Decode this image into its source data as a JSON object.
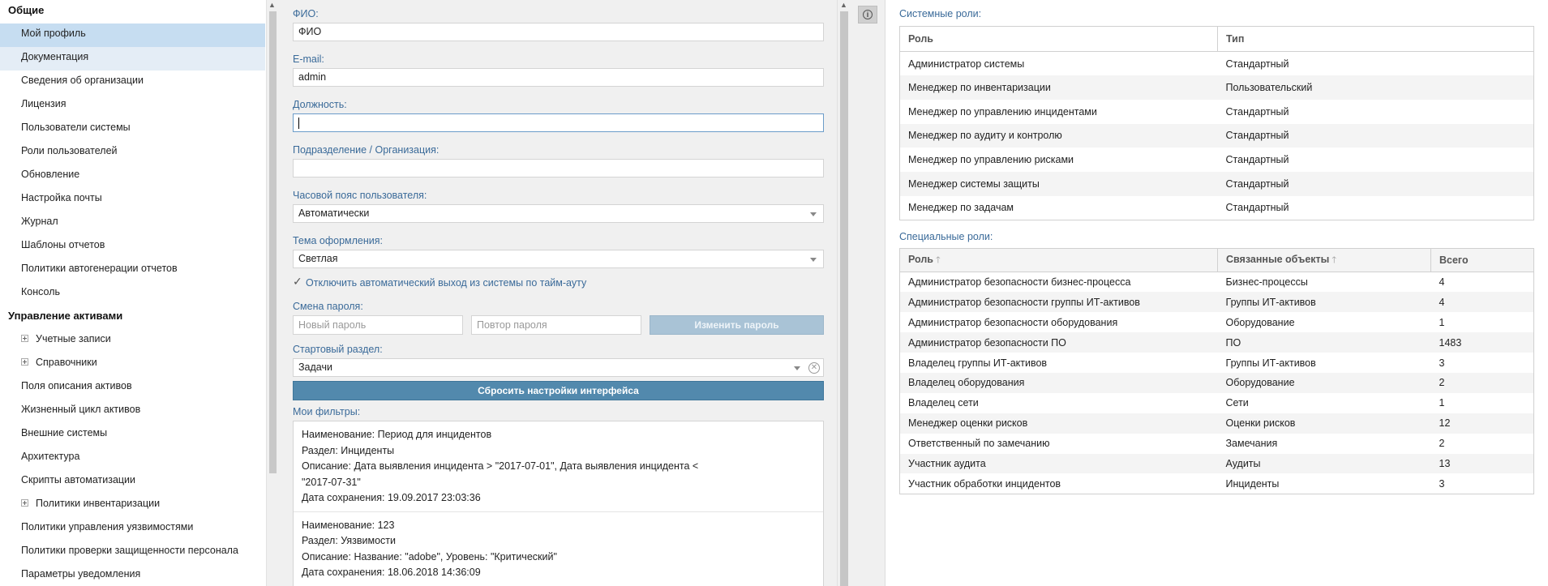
{
  "sidebar": {
    "groups": [
      {
        "title": "Общие",
        "items": [
          "Мой профиль",
          "Документация",
          "Сведения об организации",
          "Лицензия",
          "Пользователи системы",
          "Роли пользователей",
          "Обновление",
          "Настройка почты",
          "Журнал",
          "Шаблоны отчетов",
          "Политики автогенерации отчетов",
          "Консоль"
        ]
      },
      {
        "title": "Управление активами",
        "items": [
          "Учетные записи",
          "Справочники",
          "Поля описания активов",
          "Жизненный цикл активов",
          "Внешние системы",
          "Архитектура",
          "Скрипты автоматизации",
          "Политики инвентаризации",
          "Политики управления уязвимостями",
          "Политики проверки защищенности персонала",
          "Параметры уведомления"
        ]
      }
    ]
  },
  "profile": {
    "fio_label": "ФИО:",
    "fio_value": "ФИО",
    "email_label": "E-mail:",
    "email_value": "admin",
    "position_label": "Должность:",
    "position_value": "",
    "division_label": "Подразделение / Организация:",
    "division_value": "",
    "timezone_label": "Часовой пояс пользователя:",
    "timezone_value": "Автоматически",
    "theme_label": "Тема оформления:",
    "theme_value": "Светлая",
    "timeout_checkbox_label": "Отключить автоматический выход из системы по тайм-ауту",
    "timeout_checked": true,
    "password_label": "Смена пароля:",
    "new_password_placeholder": "Новый пароль",
    "repeat_password_placeholder": "Повтор пароля",
    "change_password_button": "Изменить пароль",
    "start_section_label": "Стартовый раздел:",
    "start_section_value": "Задачи",
    "reset_button": "Сбросить настройки интерфейса",
    "filters_label": "Мои фильтры:",
    "filters": [
      {
        "name": "Наименование: Период для инцидентов",
        "section": "Раздел: Инциденты",
        "description": "Описание: Дата выявления инцидента > \"2017-07-01\", Дата выявления инцидента < \"2017-07-31\"",
        "saved": "Дата сохранения: 19.09.2017 23:03:36"
      },
      {
        "name": "Наименование: 123",
        "section": "Раздел: Уязвимости",
        "description": "Описание: Название: \"adobe\", Уровень: \"Критический\"",
        "saved": "Дата сохранения: 18.06.2018 14:36:09"
      }
    ]
  },
  "system_roles": {
    "title": "Системные роли:",
    "columns": [
      "Роль",
      "Тип"
    ],
    "rows": [
      [
        "Администратор системы",
        "Стандартный"
      ],
      [
        "Менеджер по инвентаризации",
        "Пользовательский"
      ],
      [
        "Менеджер по управлению инцидентами",
        "Стандартный"
      ],
      [
        "Менеджер по аудиту и контролю",
        "Стандартный"
      ],
      [
        "Менеджер по управлению рисками",
        "Стандартный"
      ],
      [
        "Менеджер системы защиты",
        "Стандартный"
      ],
      [
        "Менеджер по задачам",
        "Стандартный"
      ]
    ]
  },
  "special_roles": {
    "title": "Специальные роли:",
    "columns": [
      "Роль",
      "Связанные объекты",
      "Всего"
    ],
    "rows": [
      [
        "Администратор безопасности бизнес-процесса",
        "Бизнес-процессы",
        "4"
      ],
      [
        "Администратор безопасности группы ИТ-активов",
        "Группы ИТ-активов",
        "4"
      ],
      [
        "Администратор безопасности оборудования",
        "Оборудование",
        "1"
      ],
      [
        "Администратор безопасности ПО",
        "ПО",
        "1483"
      ],
      [
        "Владелец группы ИТ-активов",
        "Группы ИТ-активов",
        "3"
      ],
      [
        "Владелец оборудования",
        "Оборудование",
        "2"
      ],
      [
        "Владелец сети",
        "Сети",
        "1"
      ],
      [
        "Менеджер оценки рисков",
        "Оценки рисков",
        "12"
      ],
      [
        "Ответственный по замечанию",
        "Замечания",
        "2"
      ],
      [
        "Участник аудита",
        "Аудиты",
        "13"
      ],
      [
        "Участник обработки инцидентов",
        "Инциденты",
        "3"
      ]
    ]
  }
}
